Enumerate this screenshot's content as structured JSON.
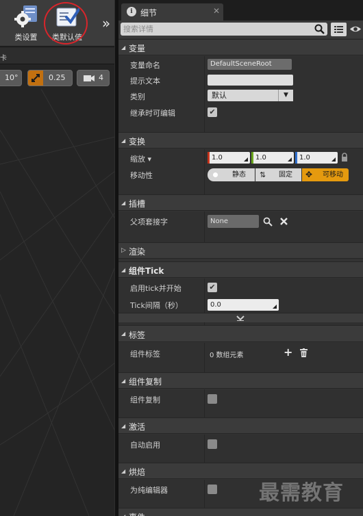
{
  "toolbar": {
    "class_settings_label": "类设置",
    "class_defaults_label": "类默认值",
    "overflow_glyph": "»"
  },
  "viewport": {
    "tab_fragment": "卡",
    "angle_snap": "10°",
    "scale_snap": "0.25",
    "camera_speed": "4"
  },
  "details": {
    "tab_title": "细节",
    "tab_close": "✕",
    "search_placeholder": "搜索详情",
    "categories": {
      "variable": "变量",
      "transform": "变换",
      "sockets": "插槽",
      "rendering": "渲染",
      "component_tick": "组件Tick",
      "tags": "标签",
      "component_replication": "组件复制",
      "activation": "激活",
      "cooking": "烘焙",
      "events": "事件"
    },
    "variable": {
      "name_label": "变量命名",
      "name_value": "DefaultSceneRoot",
      "tooltip_label": "提示文本",
      "tooltip_value": "",
      "category_label": "类别",
      "category_value": "默认",
      "editable_label": "继承时可编辑",
      "editable_checked": true
    },
    "transform": {
      "scale_label": "缩放 ▾",
      "scale_x": "1.0",
      "scale_y": "1.0",
      "scale_z": "1.0",
      "mobility_label": "移动性",
      "mobility_static": "静态",
      "mobility_stationary": "固定",
      "mobility_movable": "可移动",
      "mobility_selected": "可移动"
    },
    "sockets": {
      "parent_socket_label": "父项套接字",
      "parent_socket_value": "None"
    },
    "tick": {
      "start_label": "启用tick并开始",
      "start_checked": true,
      "interval_label": "Tick间隔（秒）",
      "interval_value": "0.0"
    },
    "tags": {
      "component_tags_label": "组件标签",
      "component_tags_value": "0 数组元素"
    },
    "replication": {
      "label": "组件复制",
      "checked": false
    },
    "activation": {
      "label": "自动启用",
      "checked": false
    },
    "cooking": {
      "label": "为纯编辑器",
      "checked": false
    }
  },
  "watermark": "最需教育",
  "colors": {
    "accent_orange": "#e59a0f",
    "axis_x": "#c8341c",
    "axis_y": "#6aa61c",
    "axis_z": "#2f6fcf",
    "highlight_circle": "#d9252b"
  }
}
